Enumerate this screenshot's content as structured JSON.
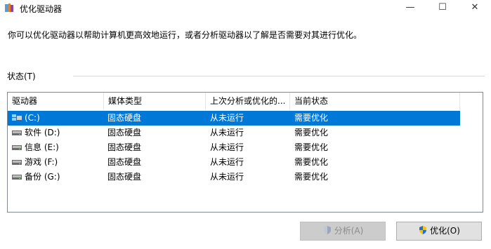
{
  "window": {
    "title": "优化驱动器",
    "minimize_glyph": "—",
    "maximize_glyph": "☐",
    "close_glyph": "✕"
  },
  "description": "你可以优化驱动器以帮助计算机更高效地运行，或者分析驱动器以了解是否需要对其进行优化。",
  "status_label": "状态(T)",
  "table": {
    "columns": [
      "驱动器",
      "媒体类型",
      "上次分析或优化的...",
      "当前状态"
    ],
    "rows": [
      {
        "drive": "(C:)",
        "media": "固态硬盘",
        "last_run": "从未运行",
        "status": "需要优化",
        "selected": true,
        "icon": "system-drive-icon"
      },
      {
        "drive": "软件 (D:)",
        "media": "固态硬盘",
        "last_run": "从未运行",
        "status": "需要优化",
        "selected": false,
        "icon": "drive-icon"
      },
      {
        "drive": "信息 (E:)",
        "media": "固态硬盘",
        "last_run": "从未运行",
        "status": "需要优化",
        "selected": false,
        "icon": "drive-icon"
      },
      {
        "drive": "游戏 (F:)",
        "media": "固态硬盘",
        "last_run": "从未运行",
        "status": "需要优化",
        "selected": false,
        "icon": "drive-icon"
      },
      {
        "drive": "备份 (G:)",
        "media": "固态硬盘",
        "last_run": "从未运行",
        "status": "需要优化",
        "selected": false,
        "icon": "drive-icon"
      }
    ]
  },
  "buttons": {
    "analyze": "分析(A)",
    "optimize": "优化(O)"
  },
  "colors": {
    "selection": "#0078d7",
    "border": "#828790"
  }
}
